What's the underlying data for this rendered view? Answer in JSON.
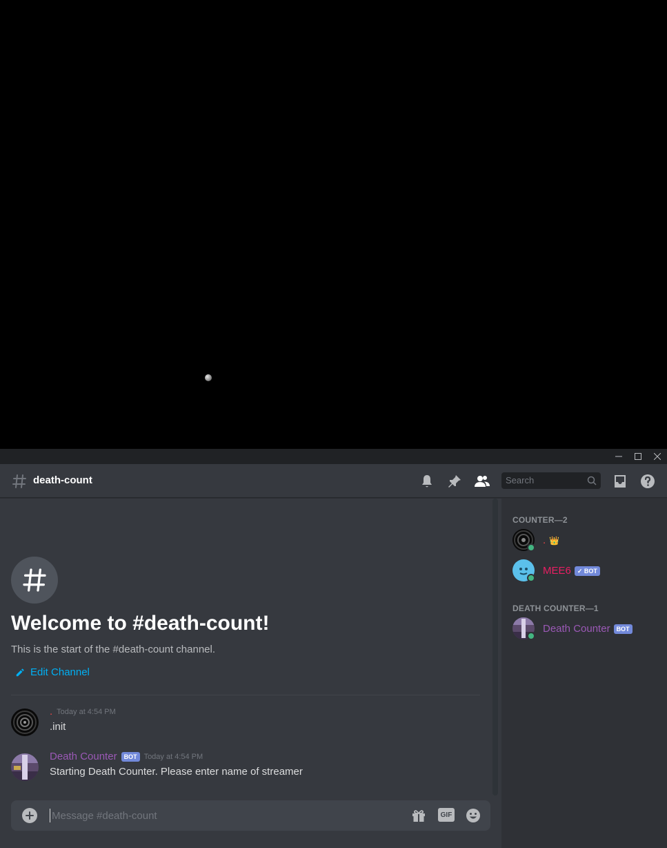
{
  "window_controls": {
    "minimize": "─",
    "maximize": "☐",
    "close": "✕"
  },
  "header": {
    "channel_name": "death-count",
    "search_placeholder": "Search"
  },
  "welcome": {
    "title": "Welcome to #death-count!",
    "subtitle": "This is the start of the #death-count channel.",
    "edit_label": "Edit Channel"
  },
  "messages": [
    {
      "username": ".",
      "user_color": "#f04747",
      "timestamp": "Today at 4:54 PM",
      "text": ".init",
      "bot": false
    },
    {
      "username": "Death Counter",
      "user_color": "#9b59b6",
      "timestamp": "Today at 4:54 PM",
      "text": "Starting Death Counter. Please enter name of streamer",
      "bot": true,
      "bot_label": "BOT"
    }
  ],
  "composer": {
    "placeholder": "Message #death-count",
    "gif_label": "GIF"
  },
  "members": {
    "groups": [
      {
        "label": "COUNTER—2",
        "items": [
          {
            "name": ".",
            "color": "#f04747",
            "crown": "👑"
          },
          {
            "name": "MEE6",
            "color": "#e91e63",
            "tag": "✓ BOT"
          }
        ]
      },
      {
        "label": "DEATH COUNTER—1",
        "items": [
          {
            "name": "Death Counter",
            "color": "#9b59b6",
            "tag": "BOT"
          }
        ]
      }
    ]
  },
  "colors": {
    "accent": "#7289da",
    "link": "#00b0f4",
    "online": "#43b581",
    "bg_chat": "#36393f",
    "bg_members": "#2f3136"
  }
}
